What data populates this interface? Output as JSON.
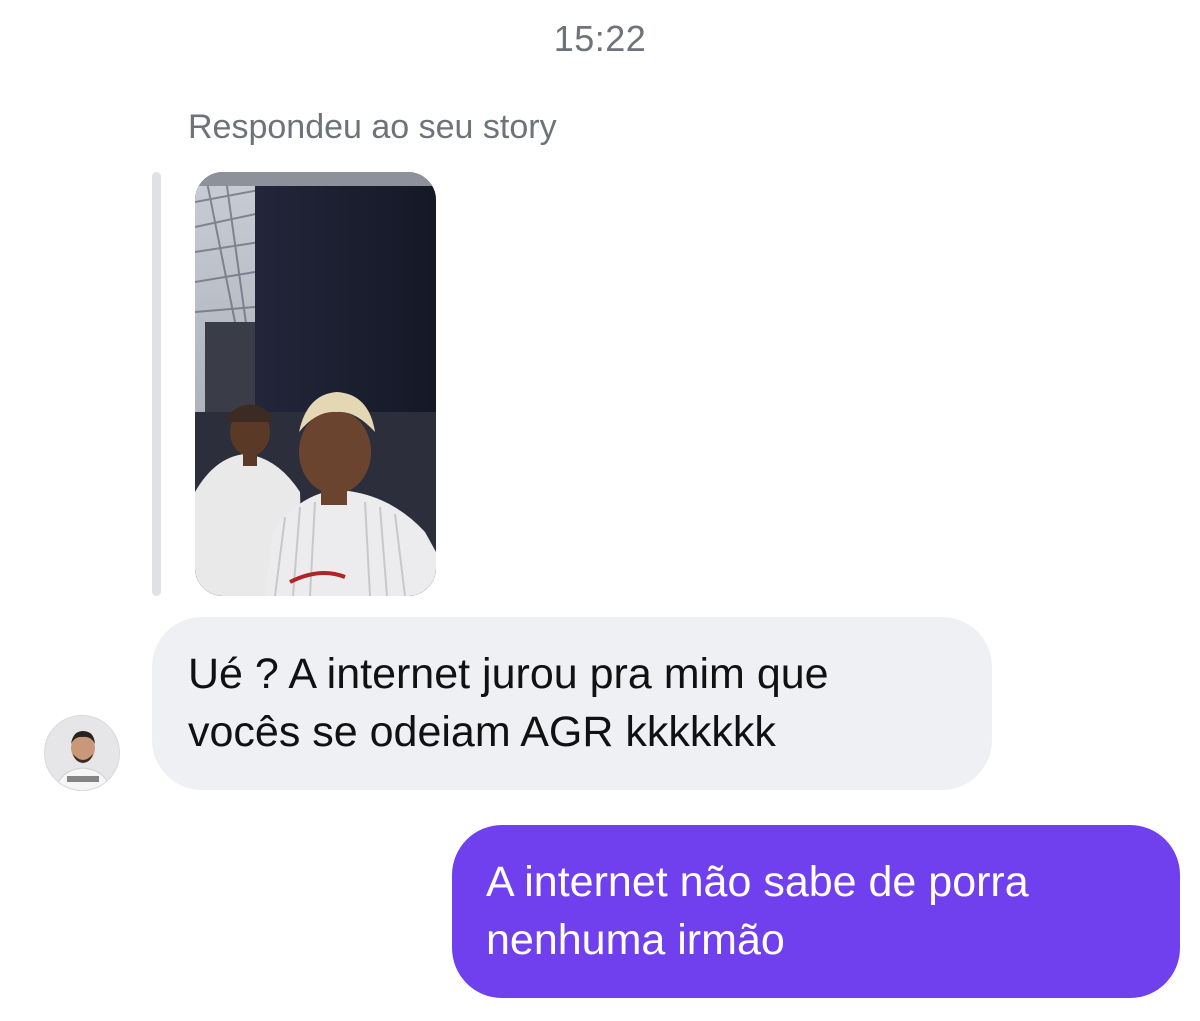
{
  "conversation": {
    "timestamp": "15:22",
    "story_reply_label": "Respondeu ao seu story",
    "messages": [
      {
        "direction": "incoming",
        "text": "Ué ? A internet jurou pra mim que\nvocês se odeiam AGR kkkkkkk"
      },
      {
        "direction": "outgoing",
        "text": "A internet não sabe de porra\nnenhuma irmão"
      }
    ]
  },
  "colors": {
    "outgoing_bubble": "#7040ee",
    "incoming_bubble": "#eff0f4",
    "meta_text": "#6e737a",
    "reply_bar": "#dfe1e5"
  },
  "icons": {
    "sender_avatar": "user-avatar-photo",
    "story_image": "story-photo-thumbnail"
  }
}
